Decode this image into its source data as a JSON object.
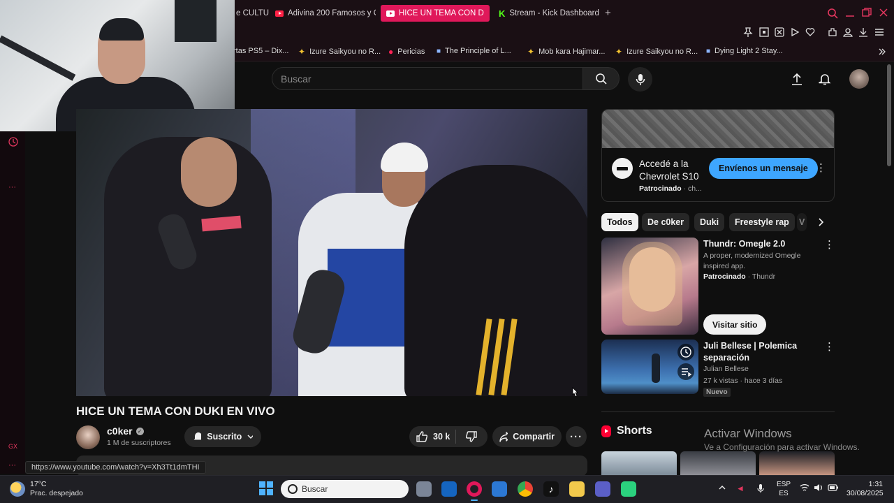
{
  "browser": {
    "tabs": [
      {
        "label": "e CULTU",
        "kind": "youtube"
      },
      {
        "label": "Adivina 200 Famosos y C",
        "kind": "youtube"
      },
      {
        "label": "HICE UN TEMA CON D",
        "kind": "youtube",
        "active": true
      },
      {
        "label": "Stream - Kick Dashboard",
        "kind": "kick"
      }
    ],
    "new_tab": "+",
    "bookmarks": [
      {
        "label": "rtas PS5 – Dix...",
        "kind": "none"
      },
      {
        "label": "Izure Saikyou no R...",
        "kind": "star"
      },
      {
        "label": "Pericias",
        "kind": "red"
      },
      {
        "label": "The Principle of L...",
        "kind": "blue"
      },
      {
        "label": "Mob kara Hajimar...",
        "kind": "star"
      },
      {
        "label": "Izure Saikyou no R...",
        "kind": "star"
      },
      {
        "label": "Dying Light 2 Stay...",
        "kind": "blue"
      }
    ],
    "status_url": "https://www.youtube.com/watch?v=Xh3Tt1dmTHI",
    "gx_label": "GX"
  },
  "youtube": {
    "search_placeholder": "Buscar",
    "video_title": "HICE UN TEMA CON DUKI EN VIVO",
    "channel_name": "c0ker",
    "subscribers": "1 M de suscriptores",
    "subscribe_label": "Suscrito",
    "likes": "30 k",
    "share_label": "Compartir",
    "ad": {
      "title": "Accedé a la Chevrolet S10",
      "sponsored": "Patrocinado",
      "sponsor_rest": "ch...",
      "cta": "Envíenos un mensaje"
    },
    "chips": [
      "Todos",
      "De c0ker",
      "Duki",
      "Freestyle rap",
      "V"
    ],
    "recommendations": [
      {
        "title": "Thundr: Omegle 2.0",
        "desc": "A proper, modernized Omegle inspired app.",
        "sponsored": "Patrocinado",
        "advertiser": "· Thundr",
        "cta": "Visitar sitio"
      },
      {
        "title": "Juli Bellese | Polemica separación",
        "channel": "Julian Bellese",
        "meta": "27 k vistas · hace 3 días",
        "badge": "Nuevo"
      }
    ],
    "shorts_label": "Shorts"
  },
  "windows_watermark": {
    "title": "Activar Windows",
    "subtitle": "Ve a Configuración para activar Windows."
  },
  "taskbar": {
    "temperature": "17°C",
    "weather": "Prac. despejado",
    "search_placeholder": "Buscar",
    "lang_top": "ESP",
    "lang_bottom": "ES",
    "time": "1:31",
    "date": "30/08/2025"
  },
  "colors": {
    "opera_accent": "#e0185a",
    "youtube_red": "#ff0033",
    "cta_blue": "#3ea6ff",
    "kick_green": "#53fc18"
  }
}
